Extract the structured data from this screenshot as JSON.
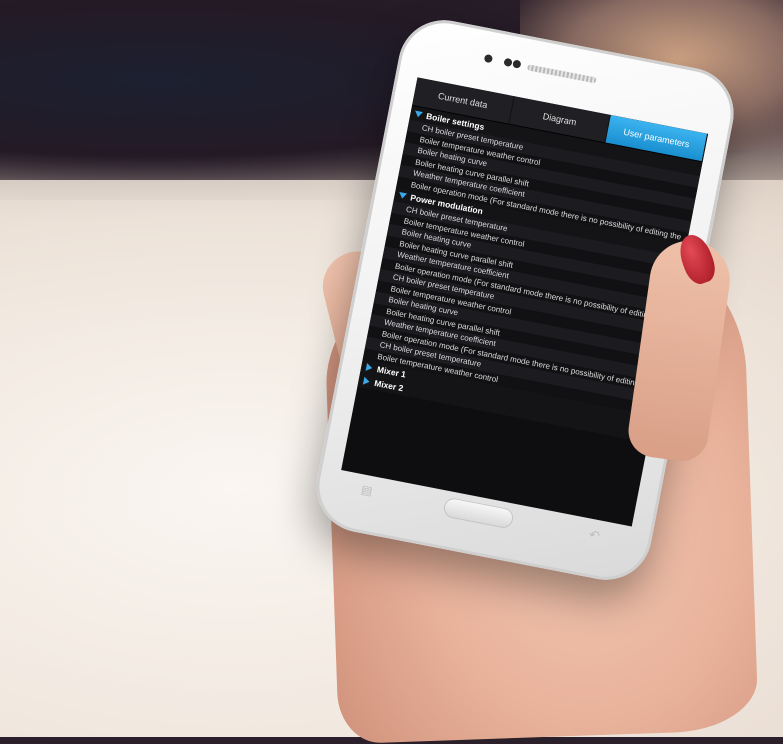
{
  "tabs": {
    "current": "Current data",
    "diagram": "Diagram",
    "user": "User parameters"
  },
  "sections": {
    "boiler": {
      "title": "Boiler settings",
      "items": [
        "CH boiler preset temperature",
        "Boiler temperature weather control",
        "Boiler heating curve",
        "Boiler heating curve parallel shift",
        "Weather temperature coefficient",
        "Boiler operation mode (For standard mode there is no possibility of editing the"
      ]
    },
    "power": {
      "title": "Power modulation",
      "items": [
        "CH boiler preset temperature",
        "Boiler temperature weather control",
        "Boiler heating curve",
        "Boiler heating curve parallel shift",
        "Weather temperature coefficient",
        "Boiler operation mode (For standard mode there is no possibility of editing th",
        "CH boiler preset temperature",
        "Boiler temperature weather control",
        "Boiler heating curve",
        "Boiler heating curve parallel shift",
        "Weather temperature coefficient",
        "Boiler operation mode (For standard mode there is no possibility of editing th",
        "CH boiler preset temperature",
        "Boiler temperature weather control"
      ]
    },
    "mixer1": {
      "title": "Mixer 1"
    },
    "mixer2": {
      "title": "Mixer 2"
    }
  },
  "icons": {
    "expanded": "triangle-down-icon",
    "collapsed": "triangle-right-icon",
    "menu": "menu-icon",
    "back": "back-arrow-icon"
  },
  "colors": {
    "accent": "#2aa2e2",
    "nail": "#c4202c"
  }
}
